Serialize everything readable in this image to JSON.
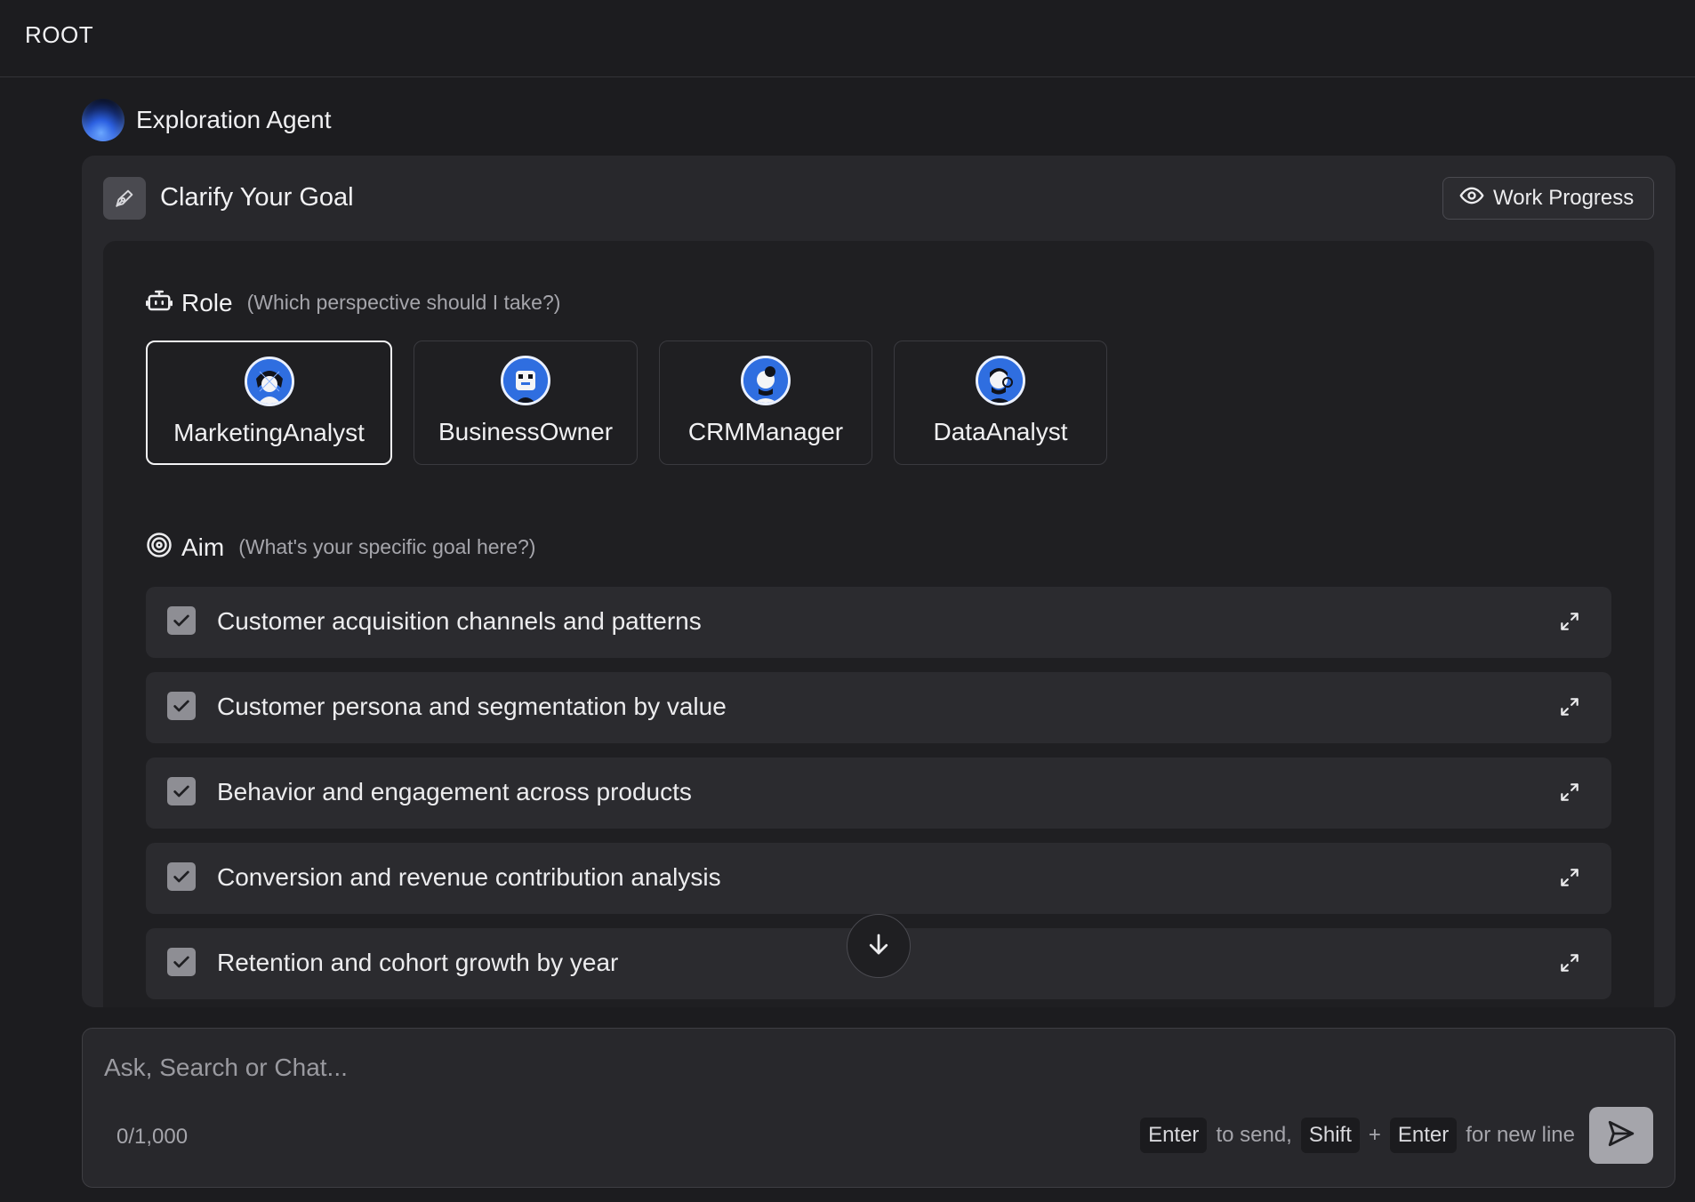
{
  "app": {
    "brand": "ROOT"
  },
  "agent": {
    "name": "Exploration Agent"
  },
  "panel": {
    "title": "Clarify Your Goal",
    "work_progress_label": "Work Progress"
  },
  "role": {
    "label": "Role",
    "hint": "(Which perspective should I take?)",
    "options": [
      {
        "label": "MarketingAnalyst",
        "selected": true
      },
      {
        "label": "BusinessOwner",
        "selected": false
      },
      {
        "label": "CRMManager",
        "selected": false
      },
      {
        "label": "DataAnalyst",
        "selected": false
      }
    ]
  },
  "aim": {
    "label": "Aim",
    "hint": "(What's your specific goal here?)",
    "items": [
      {
        "text": "Customer acquisition channels and patterns",
        "checked": true
      },
      {
        "text": "Customer persona and segmentation by value",
        "checked": true
      },
      {
        "text": "Behavior and engagement across products",
        "checked": true
      },
      {
        "text": "Conversion and revenue contribution analysis",
        "checked": true
      },
      {
        "text": "Retention and cohort growth by year",
        "checked": true
      }
    ]
  },
  "composer": {
    "placeholder": "Ask, Search or Chat...",
    "counter": "0/1,000",
    "key_enter": "Enter",
    "to_send": "to send,",
    "key_shift": "Shift",
    "plus": "+",
    "key_enter2": "Enter",
    "for_new_line": "for new line"
  }
}
